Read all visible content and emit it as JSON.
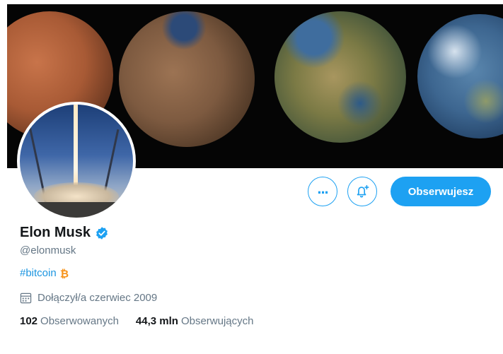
{
  "banner": {
    "description_icons": [
      "mars-planet",
      "terraformed-planet",
      "earth-like-planet",
      "earth-planet"
    ]
  },
  "profile": {
    "name": "Elon Musk",
    "verified": true,
    "handle": "@elonmusk",
    "bio_hashtag": "#bitcoin",
    "bio_emoji_icon": "bitcoin-icon",
    "joined": "Dołączył/a czerwiec 2009"
  },
  "actions": {
    "more_icon": "more-icon",
    "notifications_icon": "bell-plus-icon",
    "follow_label": "Obserwujesz"
  },
  "stats": {
    "following_count": "102",
    "following_label": "Obserwowanych",
    "followers_count": "44,3 mln",
    "followers_label": "Obserwujących"
  },
  "colors": {
    "accent": "#1da1f2",
    "link": "#1b95e0",
    "secondary_text": "#657786",
    "primary_text": "#14171a",
    "bitcoin": "#f7931a"
  }
}
